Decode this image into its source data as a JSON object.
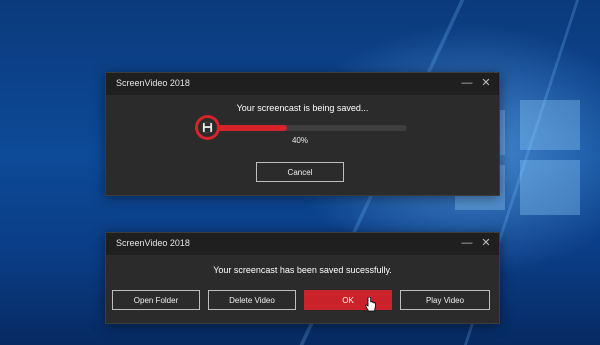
{
  "colors": {
    "desktop_bg": "#0d4a98",
    "dialog_bg": "#2b2b2b",
    "titlebar_bg": "#1f1f1f",
    "accent": "#d6242a"
  },
  "save_dialog": {
    "title": "ScreenVideo 2018",
    "message": "Your screencast is being saved...",
    "progress": 0.4,
    "progress_label": "40%",
    "icon": "floppy-disk-icon",
    "cancel_label": "Cancel",
    "minimize_icon": "minimize-icon",
    "close_icon": "close-icon"
  },
  "done_dialog": {
    "title": "ScreenVideo 2018",
    "message": "Your screencast has been saved sucessfully.",
    "buttons": {
      "open_folder": "Open Folder",
      "delete_video": "Delete Video",
      "ok": "OK",
      "play_video": "Play Video"
    },
    "minimize_icon": "minimize-icon",
    "close_icon": "close-icon"
  }
}
